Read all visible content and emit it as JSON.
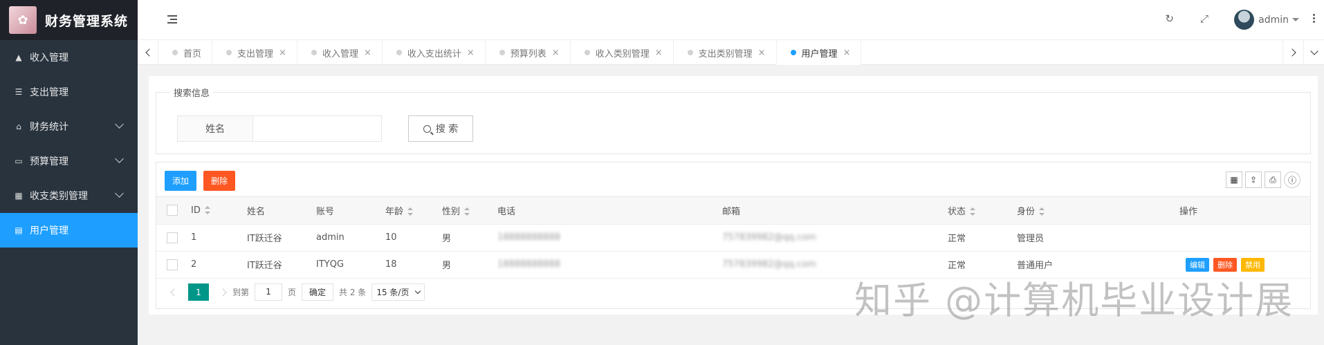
{
  "app": {
    "title": "财务管理系统"
  },
  "sidebar": {
    "items": [
      {
        "label": "收入管理",
        "icon": "graduation-cap-icon",
        "expandable": false
      },
      {
        "label": "支出管理",
        "icon": "server-icon",
        "expandable": false
      },
      {
        "label": "财务统计",
        "icon": "home-icon",
        "expandable": true
      },
      {
        "label": "预算管理",
        "icon": "window-icon",
        "expandable": true
      },
      {
        "label": "收支类别管理",
        "icon": "calendar-icon",
        "expandable": true
      },
      {
        "label": "用户管理",
        "icon": "list-icon",
        "expandable": false,
        "active": true
      }
    ]
  },
  "header": {
    "username": "admin"
  },
  "tabs": [
    {
      "label": "首页",
      "closable": false
    },
    {
      "label": "支出管理",
      "closable": true
    },
    {
      "label": "收入管理",
      "closable": true
    },
    {
      "label": "收入支出统计",
      "closable": true
    },
    {
      "label": "预算列表",
      "closable": true
    },
    {
      "label": "收入类别管理",
      "closable": true
    },
    {
      "label": "支出类别管理",
      "closable": true
    },
    {
      "label": "用户管理",
      "closable": true,
      "active": true
    }
  ],
  "search": {
    "legend": "搜索信息",
    "name_label": "姓名",
    "name_value": "",
    "button": "搜 索"
  },
  "toolbar": {
    "add": "添加",
    "delete": "删除"
  },
  "table": {
    "headers": {
      "id": "ID",
      "name": "姓名",
      "account": "账号",
      "age": "年龄",
      "gender": "性别",
      "phone": "电话",
      "email": "邮箱",
      "status": "状态",
      "role": "身份",
      "ops": "操作"
    },
    "rows": [
      {
        "id": "1",
        "name": "IT跃迁谷",
        "account": "admin",
        "age": "10",
        "gender": "男",
        "phone": "18888888888",
        "email": "757839982@qq.com",
        "status": "正常",
        "role": "管理员",
        "ops": []
      },
      {
        "id": "2",
        "name": "IT跃迁谷",
        "account": "ITYQG",
        "age": "18",
        "gender": "男",
        "phone": "18888888888",
        "email": "757839982@qq.com",
        "status": "正常",
        "role": "普通用户",
        "ops": [
          "编辑",
          "删除",
          "禁用"
        ]
      }
    ]
  },
  "pager": {
    "current": "1",
    "goto_label": "到第",
    "goto_value": "1",
    "page_unit": "页",
    "confirm": "确定",
    "total": "共 2 条",
    "page_size": "15 条/页"
  },
  "watermark": "知乎 @计算机毕业设计展",
  "colors": {
    "sidebar": "#28333e",
    "logo_bg": "#20222a",
    "active": "#1e9fff",
    "add": "#1e9fff",
    "delete": "#ff5722",
    "edit": "#1e9fff",
    "ban": "#ffb800",
    "page": "#009688"
  }
}
